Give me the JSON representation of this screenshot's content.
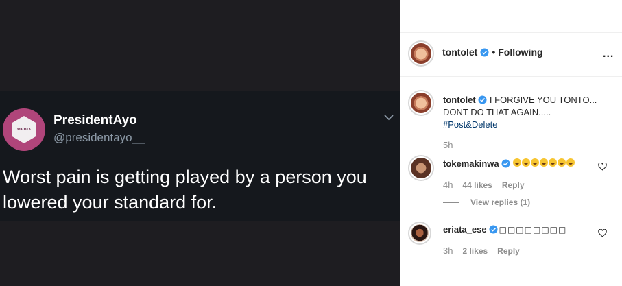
{
  "tweet": {
    "avatar_text": "MEDIA",
    "display_name": "PresidentAyo",
    "handle": "@presidentayo__",
    "text": "Worst pain is getting played by a person you lowered your standard for."
  },
  "post": {
    "header": {
      "username": "tontolet",
      "separator": "•",
      "follow_status": "Following",
      "more_icon": "..."
    },
    "caption": {
      "username": "tontolet",
      "text": "I FORGIVE YOU TONTO... DONT DO THAT AGAIN.....",
      "hashtag": "#Post",
      "suffix": "&Delete",
      "time": "5h"
    },
    "comments": [
      {
        "username": "tokemakinwa",
        "emoji_count": 7,
        "emoji_name": "grinning-face-icon",
        "time": "4h",
        "likes": "44 likes",
        "reply": "Reply",
        "view_replies": "View replies (1)"
      },
      {
        "username": "eriata_ese",
        "text": "□□□□□□□□",
        "time": "3h",
        "likes": "2 likes",
        "reply": "Reply"
      }
    ]
  },
  "colors": {
    "verified": "#3897f0",
    "tweet_background": "#15181d",
    "link": "#00376b",
    "muted": "#8e8e8e"
  }
}
